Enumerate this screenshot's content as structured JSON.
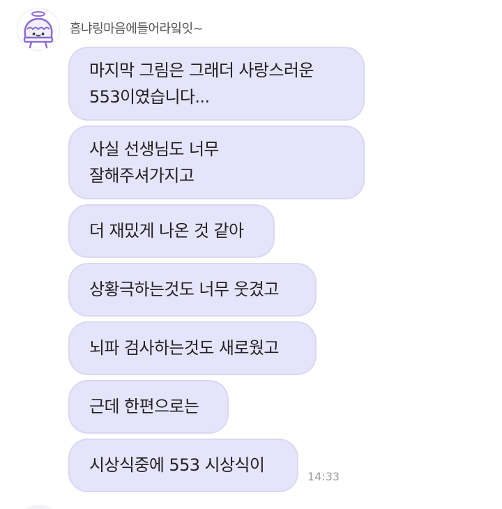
{
  "sender": {
    "name": "흠냐링마음에들어라잌잇~",
    "avatar_icon": "cake-angel-icon"
  },
  "messages": [
    {
      "lines": [
        "마지막 그림은 그래더 사랑스러운",
        "553이였습니다..."
      ]
    },
    {
      "lines": [
        "사실 선생님도 너무",
        "잘해주셔가지고"
      ]
    },
    {
      "lines": [
        "더 재밌게 나온 것 같아"
      ]
    },
    {
      "lines": [
        "상황극하는것도 너무 웃겼고"
      ]
    },
    {
      "lines": [
        "뇌파 검사하는것도 새로웠고"
      ]
    },
    {
      "lines": [
        "근데 한편으로는"
      ]
    },
    {
      "lines": [
        "시상식중에 553 시상식이"
      ]
    }
  ],
  "timestamp": "14:33",
  "colors": {
    "bubble_bg": "#e5e4fb",
    "bubble_border": "#d9d8f3",
    "avatar_accent": "#8a6bd6"
  }
}
